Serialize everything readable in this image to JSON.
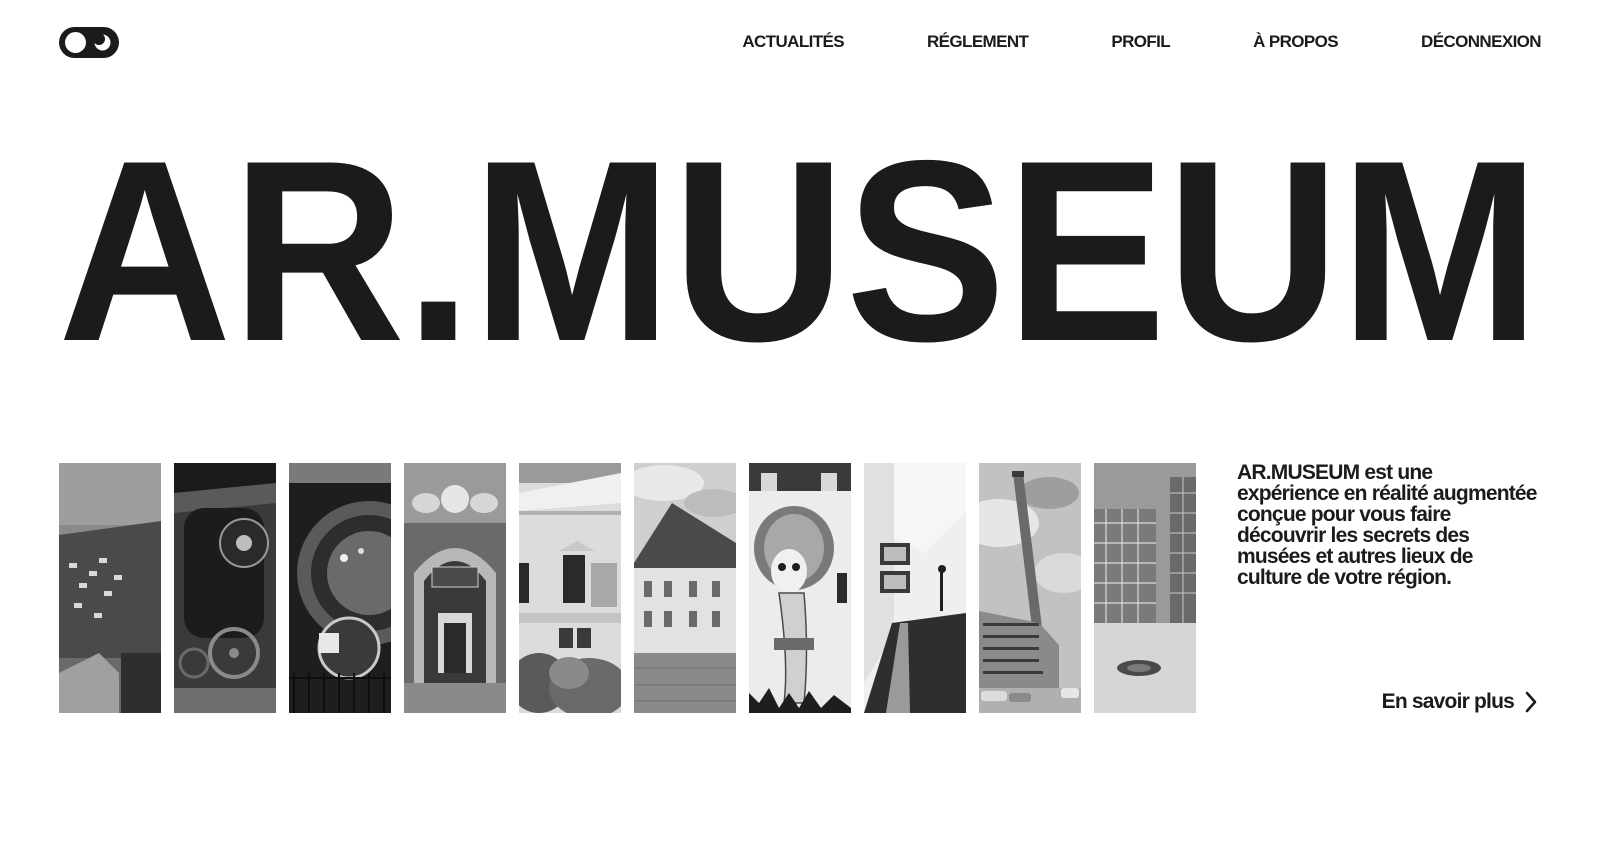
{
  "header": {
    "theme_toggle": "theme-toggle",
    "nav": [
      {
        "label": "ACTUALITÉS"
      },
      {
        "label": "RÉGLEMENT"
      },
      {
        "label": "PROFIL"
      },
      {
        "label": "À PROPOS"
      },
      {
        "label": "DÉCONNEXION"
      }
    ]
  },
  "hero": {
    "title": "AR.MUSEUM"
  },
  "gallery": {
    "images": [
      {
        "subject": "brick-building-with-plants"
      },
      {
        "subject": "steam-locomotive"
      },
      {
        "subject": "turbine-machine"
      },
      {
        "subject": "museum-entrance-arch"
      },
      {
        "subject": "museum-facade"
      },
      {
        "subject": "house-with-hip-roof"
      },
      {
        "subject": "street-art-mural"
      },
      {
        "subject": "gallery-interior"
      },
      {
        "subject": "factory-chimney"
      },
      {
        "subject": "modern-glass-building"
      }
    ]
  },
  "description": {
    "text": "AR.MUSEUM est une expérience en réalité augmentée conçue pour vous faire découvrir les secrets des musées et autres lieux de culture de votre région."
  },
  "cta": {
    "label": "En savoir plus",
    "icon": "chevron-right-icon"
  },
  "colors": {
    "ink": "#1b1b1b",
    "background": "#ffffff"
  }
}
